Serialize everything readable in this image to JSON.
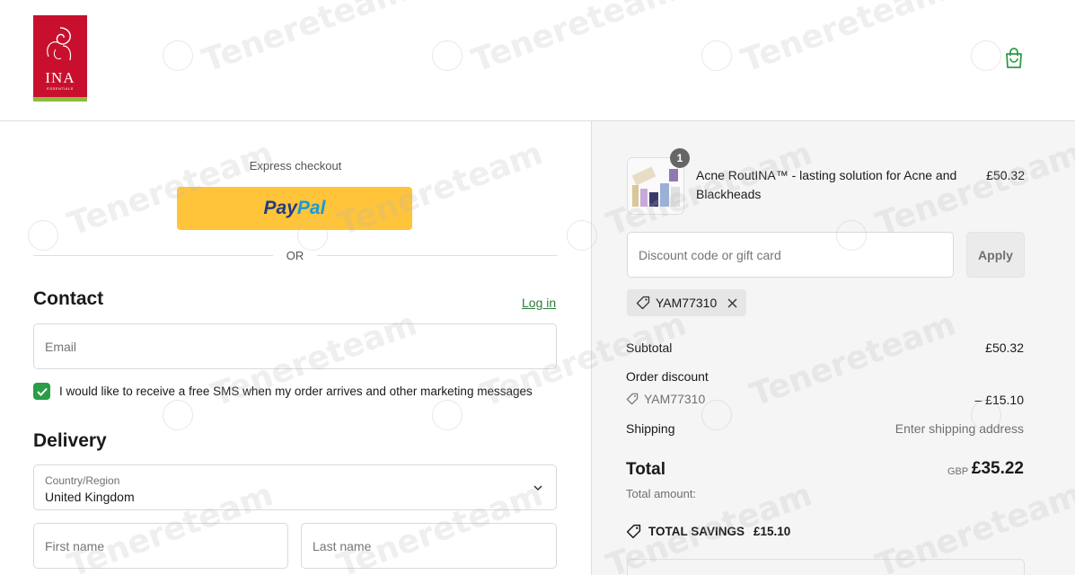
{
  "header": {
    "logo_text": "INA",
    "logo_subtext": "ESSENTIALS",
    "cart_icon": "shopping-bag-icon"
  },
  "express": {
    "label": "Express checkout",
    "paypal_pay": "Pay",
    "paypal_pal": "Pal",
    "or_text": "OR"
  },
  "contact": {
    "title": "Contact",
    "login_link": "Log in",
    "email_placeholder": "Email",
    "sms_checked": true,
    "sms_label": "I would like to receive a free SMS when my order arrives and other marketing messages"
  },
  "delivery": {
    "title": "Delivery",
    "country_label": "Country/Region",
    "country_value": "United Kingdom",
    "first_name_placeholder": "First name",
    "last_name_placeholder": "Last name"
  },
  "summary": {
    "item": {
      "quantity": "1",
      "name": "Acne RoutINA™ - lasting solution for Acne and Blackheads",
      "price": "£50.32"
    },
    "discount_placeholder": "Discount code or gift card",
    "apply_label": "Apply",
    "applied_code": "YAM77310",
    "subtotal_label": "Subtotal",
    "subtotal_value": "£50.32",
    "order_discount_label": "Order discount",
    "discount_code": "YAM77310",
    "discount_value": "– £15.10",
    "shipping_label": "Shipping",
    "shipping_value": "Enter shipping address",
    "total_label": "Total",
    "total_currency": "GBP",
    "total_value": "£35.22",
    "total_sub": "Total amount:",
    "savings_label": "TOTAL SAVINGS",
    "savings_value": "£15.10"
  },
  "watermark": "Tenereteam",
  "colors": {
    "accent": "#2a7d3b",
    "checkbox": "#2a9d46",
    "paypal_yellow": "#ffc439",
    "brand_red": "#c8102e",
    "brand_green": "#8dbb3f"
  }
}
